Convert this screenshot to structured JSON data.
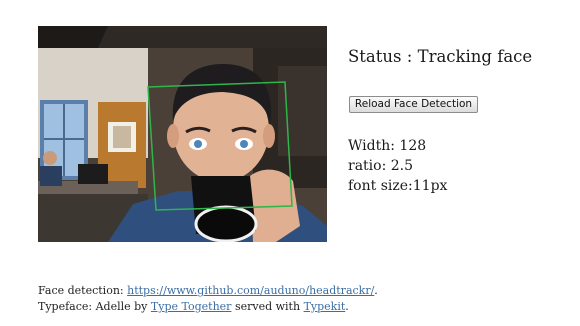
{
  "status": {
    "label": "Status",
    "separator": " : ",
    "value": "Tracking face"
  },
  "reload_button_label": "Reload Face Detection",
  "metrics": {
    "width_label": "Width:",
    "width_value": "128",
    "ratio_label": "ratio:",
    "ratio_value": "2.5",
    "font_label": "font size:",
    "font_value": "11px"
  },
  "credits": {
    "face_label": "Face detection:",
    "face_link": "https://www.github.com/auduno/headtrackr/",
    "face_end": ".",
    "typeface_label": "Typeface: Adelle by",
    "type_together_link": "Type Together",
    "served_with": "served with",
    "typekit_link": "Typekit",
    "typeface_end": "."
  },
  "colors": {
    "link": "#3b6ea5",
    "tracking_box": "#2fb54a",
    "text": "#1a1a1a"
  }
}
